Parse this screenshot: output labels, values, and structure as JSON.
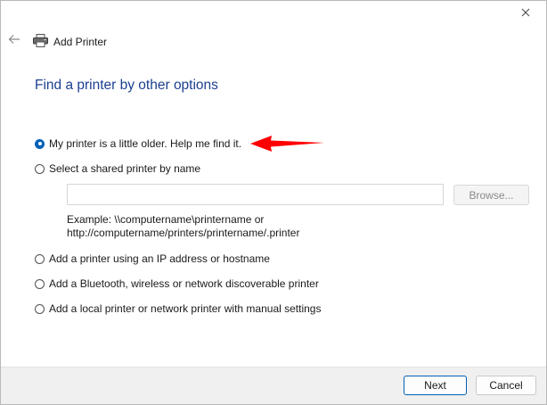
{
  "window": {
    "title": "Add Printer",
    "close_label": "✕",
    "back_label": "←"
  },
  "page": {
    "heading": "Find a printer by other options"
  },
  "options": [
    {
      "label": "My printer is a little older. Help me find it.",
      "checked": true
    },
    {
      "label": "Select a shared printer by name",
      "checked": false
    },
    {
      "label": "Add a printer using an IP address or hostname",
      "checked": false
    },
    {
      "label": "Add a Bluetooth, wireless or network discoverable printer",
      "checked": false
    },
    {
      "label": "Add a local printer or network printer with manual settings",
      "checked": false
    }
  ],
  "shared_printer": {
    "value": "",
    "placeholder": "",
    "browse_label": "Browse...",
    "example_line1": "Example: \\\\computername\\printername or",
    "example_line2": "http://computername/printers/printername/.printer"
  },
  "footer": {
    "next_label": "Next",
    "cancel_label": "Cancel"
  },
  "colors": {
    "heading": "#1c3f91",
    "accent": "#005fb8",
    "annotation_arrow": "#ff0000"
  },
  "icons": {
    "printer": "printer-icon",
    "back": "back-arrow-icon",
    "close": "close-icon",
    "annotation": "annotation-arrow-icon"
  }
}
